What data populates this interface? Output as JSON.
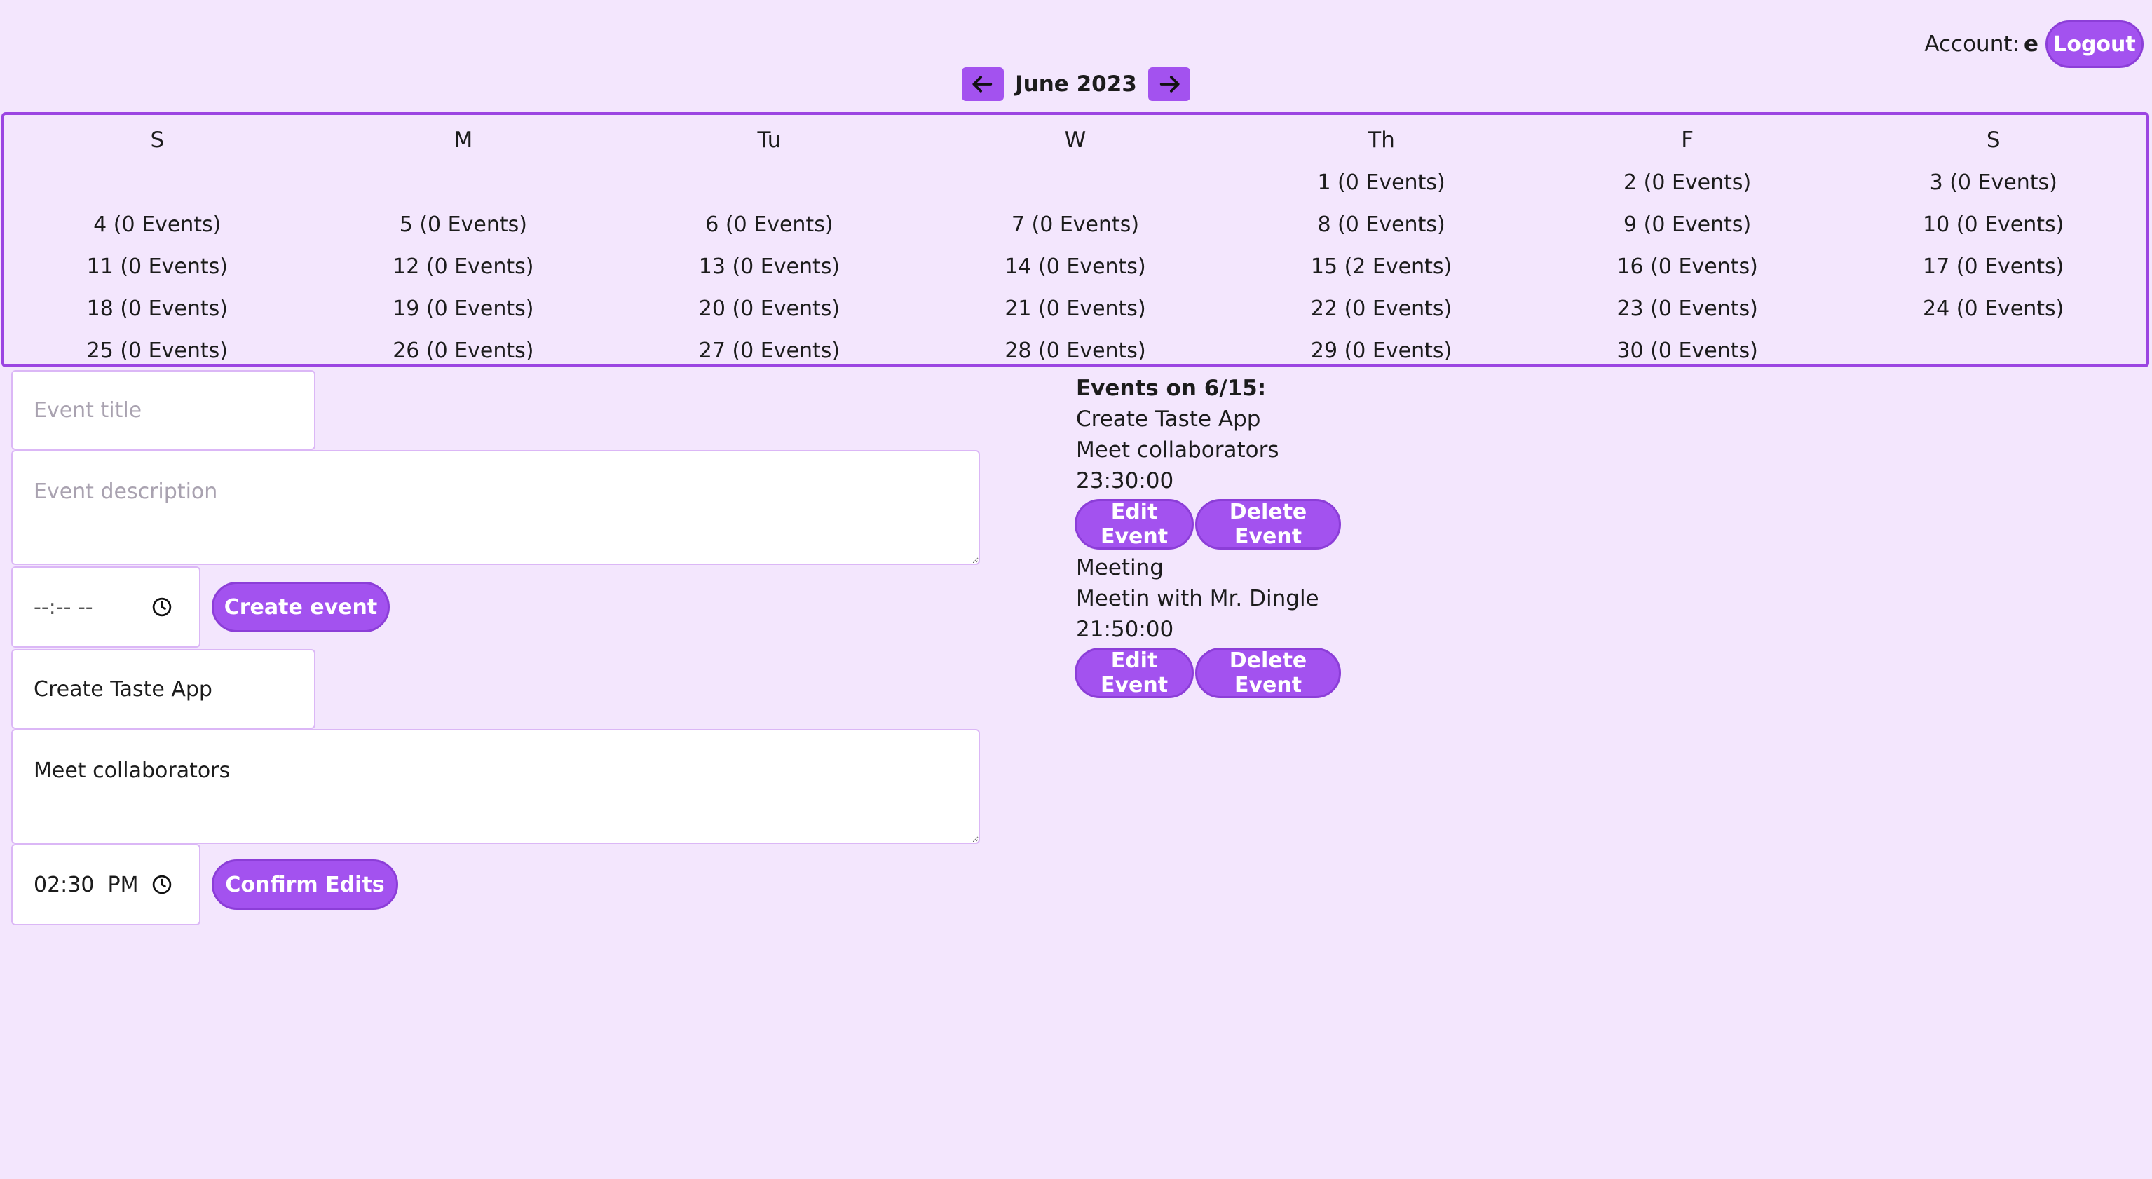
{
  "header": {
    "account_label": "Account:",
    "account_user": "e",
    "logout_label": "Logout"
  },
  "nav": {
    "month_label": "June 2023",
    "prev_icon": "arrow-left-icon",
    "next_icon": "arrow-right-icon"
  },
  "calendar": {
    "weekdays": [
      "S",
      "M",
      "Tu",
      "W",
      "Th",
      "F",
      "S"
    ],
    "cells": [
      "",
      "",
      "",
      "",
      "1 (0 Events)",
      "2 (0 Events)",
      "3 (0 Events)",
      "4 (0 Events)",
      "5 (0 Events)",
      "6 (0 Events)",
      "7 (0 Events)",
      "8 (0 Events)",
      "9 (0 Events)",
      "10 (0 Events)",
      "11 (0 Events)",
      "12 (0 Events)",
      "13 (0 Events)",
      "14 (0 Events)",
      "15 (2 Events)",
      "16 (0 Events)",
      "17 (0 Events)",
      "18 (0 Events)",
      "19 (0 Events)",
      "20 (0 Events)",
      "21 (0 Events)",
      "22 (0 Events)",
      "23 (0 Events)",
      "24 (0 Events)",
      "25 (0 Events)",
      "26 (0 Events)",
      "27 (0 Events)",
      "28 (0 Events)",
      "29 (0 Events)",
      "30 (0 Events)",
      ""
    ]
  },
  "create_form": {
    "title_placeholder": "Event title",
    "description_placeholder": "Event description",
    "time_value": "--:-- --",
    "submit_label": "Create event"
  },
  "edit_form": {
    "title_value": "Create Taste App",
    "description_value": "Meet collaborators",
    "time_value": "02:30  PM",
    "submit_label": "Confirm Edits"
  },
  "events": {
    "heading": "Events on 6/15:",
    "items": [
      {
        "title": "Create Taste App",
        "description": "Meet collaborators",
        "time": "23:30:00",
        "edit_label": "Edit Event",
        "delete_label": "Delete Event"
      },
      {
        "title": "Meeting",
        "description": "Meetin with Mr. Dingle",
        "time": "21:50:00",
        "edit_label": "Edit Event",
        "delete_label": "Delete Event"
      }
    ]
  },
  "colors": {
    "background": "#f3e6fd",
    "accent": "#a352ef",
    "border": "#9b45e2"
  }
}
